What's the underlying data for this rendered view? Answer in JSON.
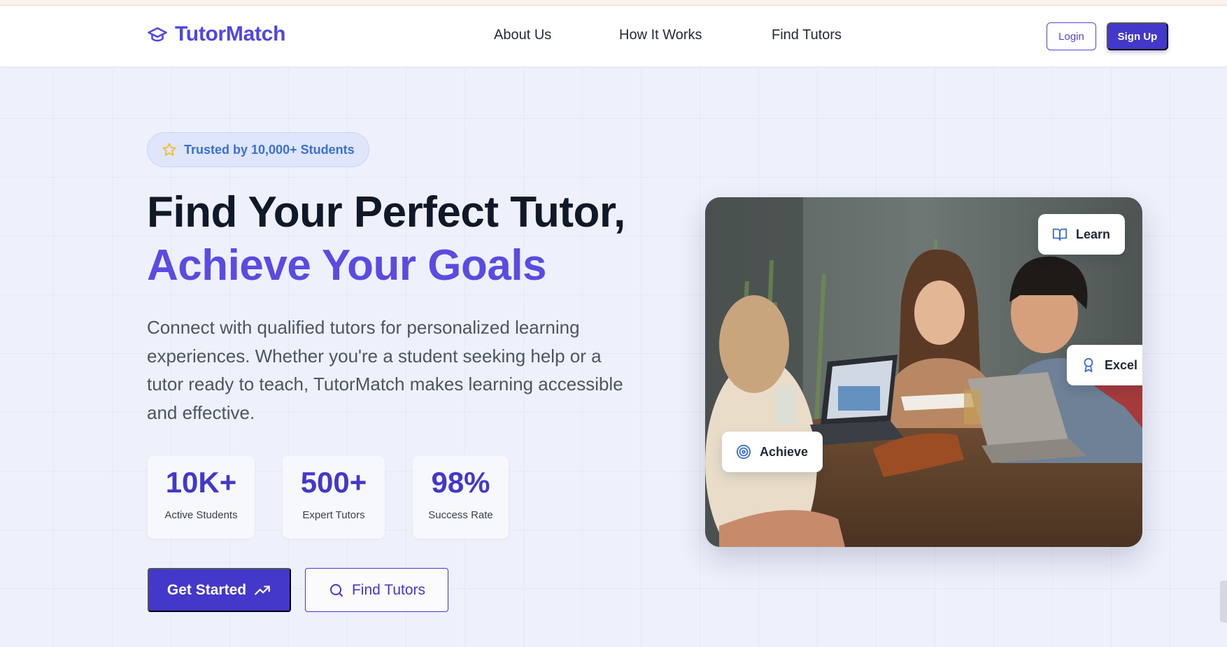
{
  "nav": {
    "brand": "TutorMatch",
    "links": [
      "About Us",
      "How It Works",
      "Find Tutors"
    ],
    "login": "Login",
    "signup": "Sign Up"
  },
  "hero": {
    "badge": "Trusted by 10,000+ Students",
    "title_line1": "Find Your Perfect Tutor,",
    "title_line2": "Achieve Your Goals",
    "description": "Connect with qualified tutors for personalized learning experiences. Whether you're a student seeking help or a tutor ready to teach, TutorMatch makes learning accessible and effective.",
    "stats": [
      {
        "value": "10K+",
        "label": "Active Students"
      },
      {
        "value": "500+",
        "label": "Expert Tutors"
      },
      {
        "value": "98%",
        "label": "Success Rate"
      }
    ],
    "cta_primary": "Get Started",
    "cta_secondary": "Find Tutors"
  },
  "image_chips": {
    "learn": "Learn",
    "excel": "Excel",
    "achieve": "Achieve"
  },
  "colors": {
    "brand": "#4f46e5",
    "accent_title": "#5b4be0",
    "badge_text": "#3b6fd4",
    "star": "#f5b82e"
  },
  "icons": {
    "brand": "graduation-cap-icon",
    "badge": "star-icon",
    "cta_primary": "trending-up-icon",
    "cta_secondary": "search-icon",
    "learn": "book-open-icon",
    "excel": "award-icon",
    "achieve": "target-icon"
  }
}
